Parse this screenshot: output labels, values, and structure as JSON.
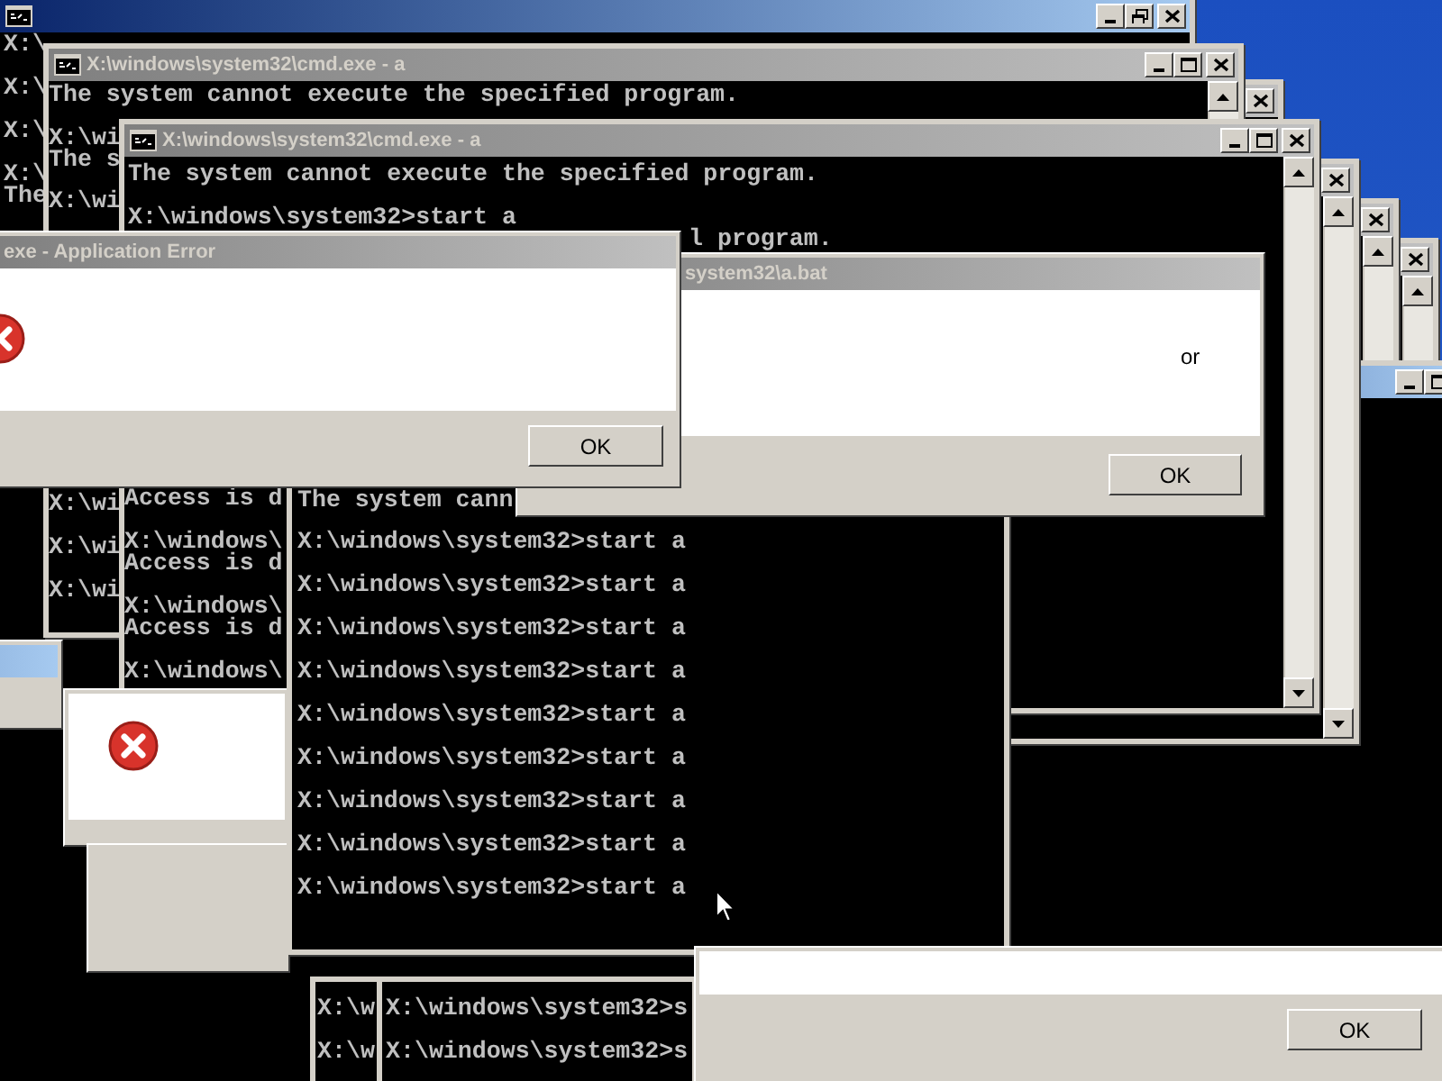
{
  "windows": [
    {
      "kind": "console",
      "active": true,
      "lines": [
        "X:\\",
        "X:\\",
        "X:\\",
        "X:\\",
        "The"
      ]
    },
    {
      "kind": "console",
      "active": false
    },
    {
      "kind": "console",
      "active": false
    },
    {
      "kind": "console",
      "active": true
    },
    {
      "kind": "console",
      "active": false
    },
    {
      "kind": "console",
      "active": false
    },
    {
      "kind": "console",
      "active": false,
      "title": "X:\\windows\\system32\\cmd.exe - a",
      "lines": [
        "The system cannot execute the specified program.",
        "X:\\wi",
        "The s",
        "X:\\wi",
        "X:\\wi",
        "X:\\wi",
        "X:\\wi"
      ]
    },
    {
      "kind": "console",
      "active": false,
      "title": "X:\\windows\\system32\\cmd.exe - a",
      "lines": [
        "The system cannot execute the specified program.",
        "X:\\windows\\system32>start a",
        "l program.",
        "Access is d",
        "X:\\windows\\",
        "Access is d",
        "X:\\windows\\",
        "Access is d",
        "X:\\windows\\"
      ]
    },
    {
      "kind": "message_dialog",
      "active": true
    },
    {
      "kind": "error_dialog"
    },
    {
      "kind": "message_dialog"
    },
    {
      "kind": "console",
      "lines": [
        "The system cann",
        "X:\\windows\\system32>start a",
        "X:\\windows\\system32>start a",
        "X:\\windows\\system32>start a",
        "X:\\windows\\system32>start a",
        "X:\\windows\\system32>start a",
        "X:\\windows\\system32>start a",
        "X:\\windows\\system32>start a",
        "X:\\windows\\system32>start a",
        "X:\\windows\\system32>start a"
      ]
    },
    {
      "kind": "message_dialog",
      "active": false,
      "title": "system32\\a.bat",
      "message": "or",
      "button": "OK"
    },
    {
      "kind": "error_dialog",
      "active": false,
      "title": "exe - Application Error",
      "button": "OK"
    },
    {
      "kind": "console",
      "lines": [
        "X:\\w",
        "X:\\w"
      ]
    },
    {
      "kind": "console",
      "lines": [
        "X:\\windows\\system32>s",
        "X:\\windows\\system32>s"
      ]
    },
    {
      "kind": "message_dialog",
      "button": "OK"
    }
  ]
}
